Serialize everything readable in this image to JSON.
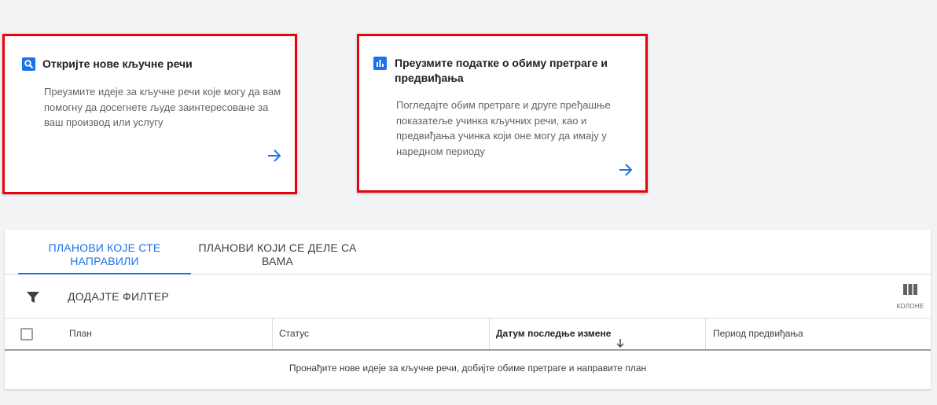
{
  "cards": {
    "discover": {
      "icon": "search-icon",
      "title": "Откријте нове кључне речи",
      "description": "Преузмите идеје за кључне речи које могу да вам помогну да досегнете људе заинтересоване за ваш производ или услугу",
      "arrow_icon": "arrow-right-icon"
    },
    "forecast": {
      "icon": "bar-chart-icon",
      "title": "Преузмите податке о обиму претраге и предвиђања",
      "description": "Погледајте обим претраге и друге пређашње показатеље учинка кључних речи, као и предвиђања учинка који оне могу да имају у наредном периоду",
      "arrow_icon": "arrow-right-icon"
    }
  },
  "plans": {
    "tabs": [
      {
        "label": "ПЛАНОВИ КОЈЕ СТЕ НАПРАВИЛИ",
        "active": true
      },
      {
        "label": "ПЛАНОВИ КОЈИ СЕ ДЕЛЕ СА ВАМА",
        "active": false
      }
    ],
    "filter": {
      "icon": "filter-icon",
      "label": "ДОДАЈТЕ ФИЛТЕР"
    },
    "columns_button": {
      "icon": "columns-icon",
      "label": "КОЛОНЕ"
    },
    "table": {
      "headers": [
        "План",
        "Статус",
        "Датум последње измене",
        "Период предвиђања"
      ],
      "sort_icon": "arrow-down-icon",
      "empty_message": "Пронађите нове идеје за кључне речи, добијте обиме претраге и направите план"
    }
  },
  "colors": {
    "accent": "#1a73e8",
    "highlight_border": "#e8000b",
    "background": "#f1f3f4"
  }
}
